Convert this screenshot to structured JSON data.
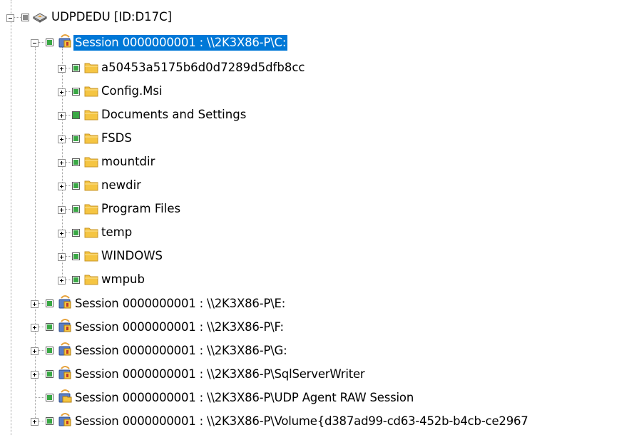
{
  "tree": {
    "root": {
      "label": "UDPDEDU [ID:D17C]",
      "icon": "hard-drive-icon",
      "check": "partial-gray"
    },
    "session_c": {
      "label": "Session 0000000001 : \\\\2K3X86-P\\C:",
      "icon": "session-icon",
      "selected": true
    },
    "folders": [
      {
        "label": "a50453a5175b6d0d7289d5dfb8cc",
        "icon": "folder-icon"
      },
      {
        "label": "Config.Msi",
        "icon": "folder-icon"
      },
      {
        "label": "Documents and Settings",
        "icon": "folder-icon",
        "check": "full"
      },
      {
        "label": "FSDS",
        "icon": "folder-icon"
      },
      {
        "label": "mountdir",
        "icon": "folder-icon"
      },
      {
        "label": "newdir",
        "icon": "folder-icon"
      },
      {
        "label": "Program Files",
        "icon": "folder-icon"
      },
      {
        "label": "temp",
        "icon": "folder-icon"
      },
      {
        "label": "WINDOWS",
        "icon": "folder-icon"
      },
      {
        "label": "wmpub",
        "icon": "folder-icon"
      }
    ],
    "sessions": [
      {
        "label": "Session 0000000001 : \\\\2K3X86-P\\E:",
        "icon": "session-icon"
      },
      {
        "label": "Session 0000000001 : \\\\2K3X86-P\\F:",
        "icon": "session-icon"
      },
      {
        "label": "Session 0000000001 : \\\\2K3X86-P\\G:",
        "icon": "session-icon"
      },
      {
        "label": "Session 0000000001 : \\\\2K3X86-P\\SqlServerWriter",
        "icon": "session-icon"
      },
      {
        "label": "Session 0000000001 : \\\\2K3X86-P\\UDP Agent RAW Session",
        "icon": "open-folder-session-icon"
      },
      {
        "label": "Session 0000000001 : \\\\2K3X86-P\\Volume{d387ad99-cd63-452b-b4cb-ce2967",
        "icon": "session-icon"
      }
    ]
  },
  "colors": {
    "check_green": "#3aa845",
    "selection": "#0078d7",
    "folder_yellow": "#f5c542"
  }
}
